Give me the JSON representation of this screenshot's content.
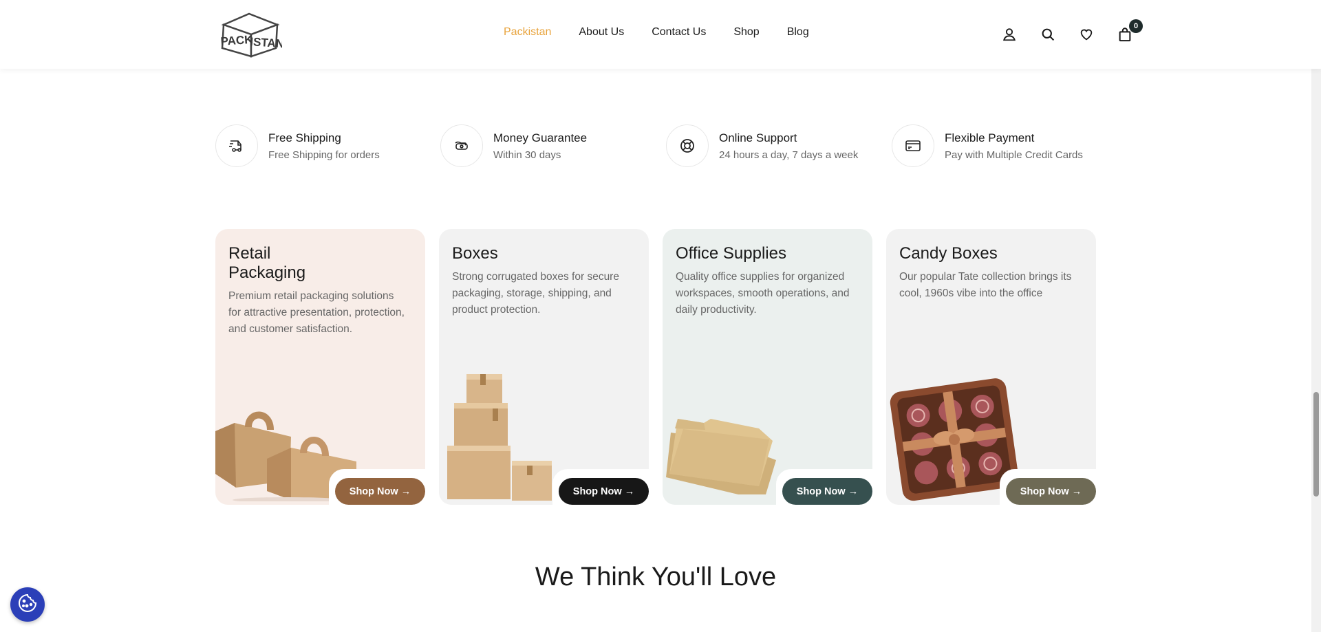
{
  "header": {
    "logo_text": "PACKISTAN",
    "nav": [
      "Packistan",
      "About Us",
      "Contact Us",
      "Shop",
      "Blog"
    ],
    "active_nav": "Packistan",
    "cart_count": "0"
  },
  "features": [
    {
      "title": "Free Shipping",
      "subtitle": "Free Shipping for orders",
      "icon": "truck-icon"
    },
    {
      "title": "Money Guarantee",
      "subtitle": "Within 30 days",
      "icon": "money-icon"
    },
    {
      "title": "Online Support",
      "subtitle": "24 hours a day, 7 days a week",
      "icon": "lifebuoy-icon"
    },
    {
      "title": "Flexible Payment",
      "subtitle": "Pay with Multiple Credit Cards",
      "icon": "credit-card-icon"
    }
  ],
  "cards": [
    {
      "title": "Retail\nPackaging",
      "description": "Premium retail packaging solutions for attractive presentation, protection, and customer satisfaction.",
      "button": "Shop Now",
      "bg": "#f8ede8",
      "btn_color": "#93643f"
    },
    {
      "title": "Boxes",
      "description": "Strong corrugated boxes for secure packaging, storage, shipping, and product protection.",
      "button": "Shop Now",
      "bg": "#f2f2f2",
      "btn_color": "#171717"
    },
    {
      "title": "Office Supplies",
      "description": "Quality office supplies for organized workspaces, smooth operations, and daily productivity.",
      "button": "Shop Now",
      "bg": "#ebf0ee",
      "btn_color": "#36504f"
    },
    {
      "title": "Candy Boxes",
      "description": "Our popular Tate collection brings its cool, 1960s vibe into the office",
      "button": "Shop Now",
      "bg": "#f2f2f2",
      "btn_color": "#6e6a55"
    }
  ],
  "section": {
    "title": "We Think You'll Love"
  },
  "colors": {
    "accent": "#e8a33b",
    "cookie_button": "#2b3fb8"
  }
}
